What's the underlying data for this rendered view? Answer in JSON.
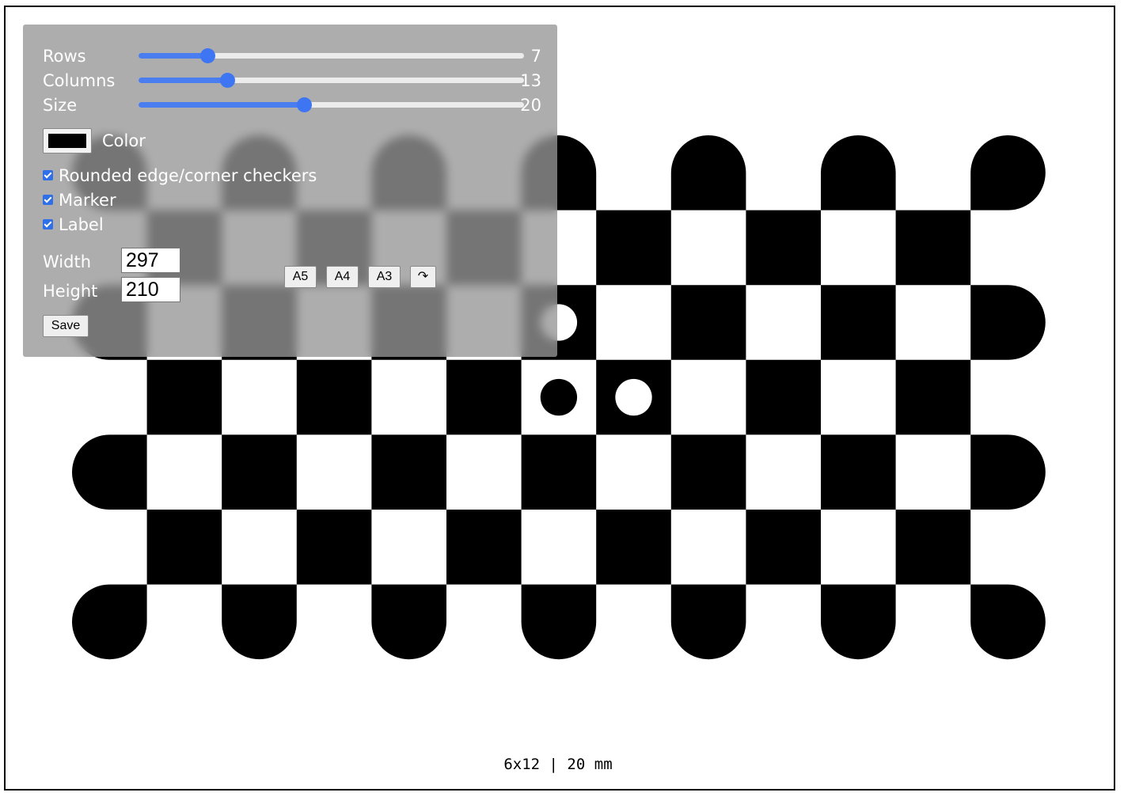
{
  "controls": {
    "rows": {
      "label": "Rows",
      "value": "7",
      "min": 2,
      "max": 30
    },
    "columns": {
      "label": "Columns",
      "value": "13",
      "min": 2,
      "max": 50
    },
    "size": {
      "label": "Size",
      "value": "20",
      "min": 5,
      "max": 40
    }
  },
  "color": {
    "label": "Color",
    "value": "#000000"
  },
  "options": {
    "rounded_label": "Rounded edge/corner checkers",
    "rounded_checked": true,
    "marker_label": "Marker",
    "marker_checked": true,
    "label_label": "Label",
    "label_checked": true
  },
  "dimensions": {
    "width_label": "Width",
    "width_value": "297",
    "height_label": "Height",
    "height_value": "210"
  },
  "presets": [
    "A5",
    "A4",
    "A3"
  ],
  "rotate_icon": "rotate-icon",
  "rotate_glyph": "↷",
  "save_label": "Save",
  "page_label": "6x12 | 20 mm",
  "board": {
    "rows": 7,
    "columns": 13,
    "color": "#000000",
    "rounded": true,
    "marker": true
  }
}
